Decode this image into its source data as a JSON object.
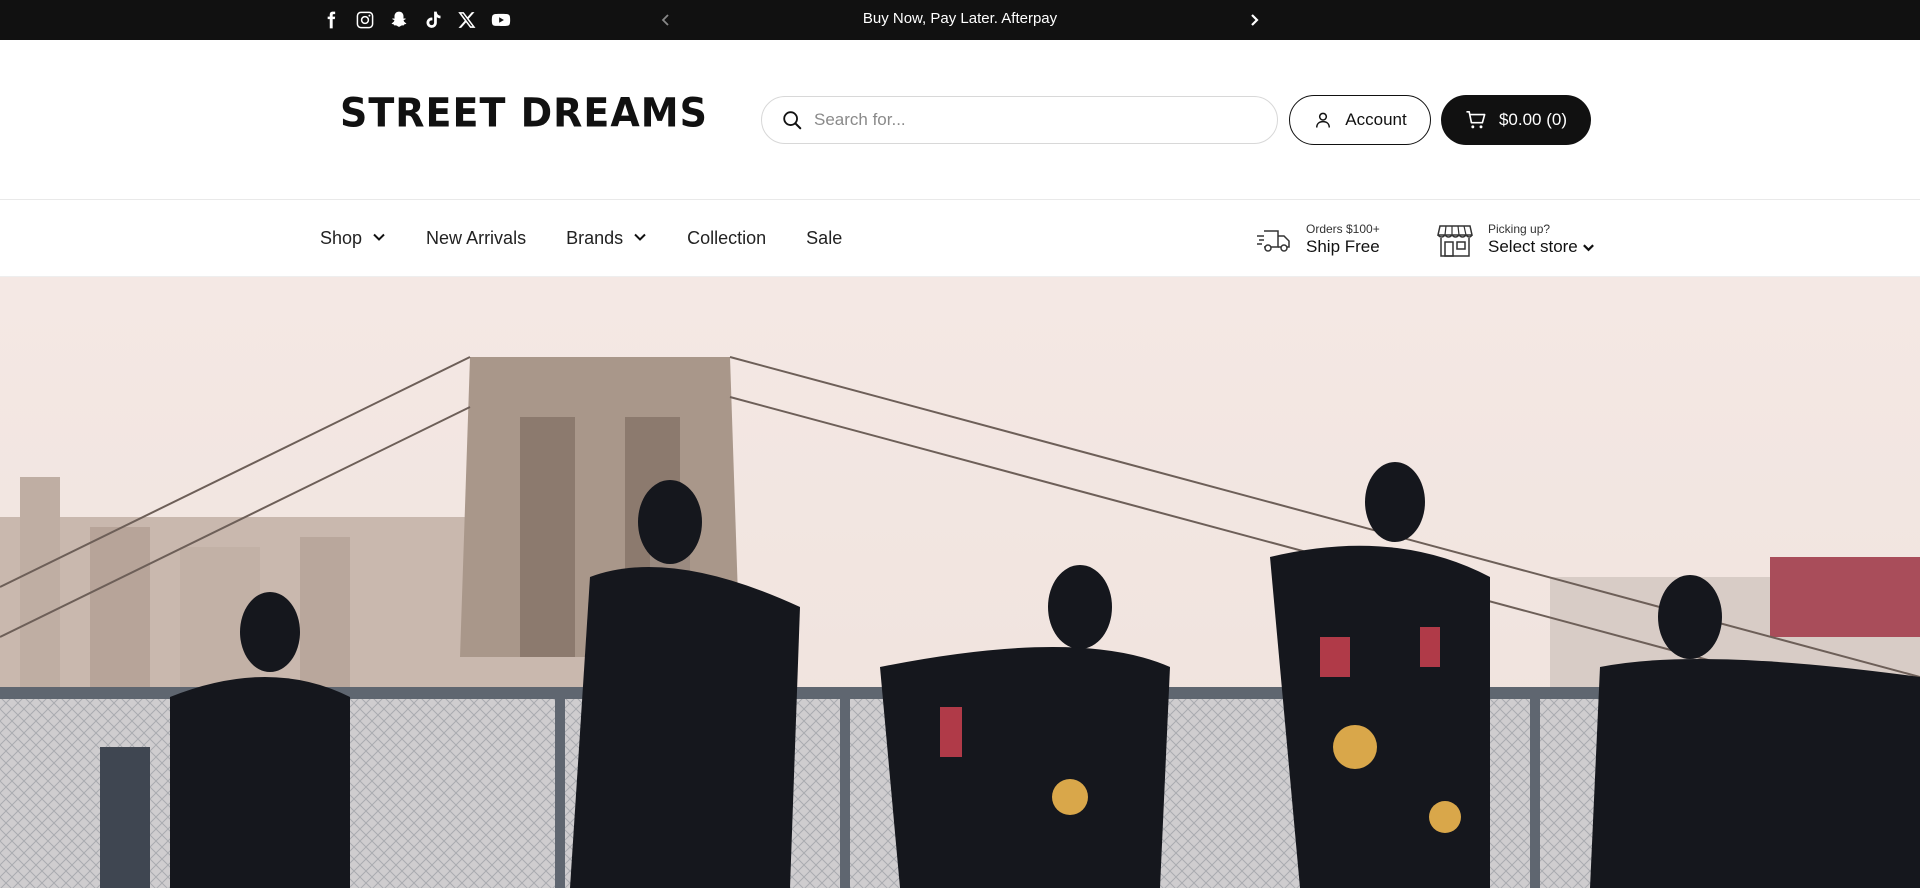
{
  "topbar": {
    "socials": [
      {
        "icon": "facebook-icon"
      },
      {
        "icon": "instagram-icon"
      },
      {
        "icon": "snapchat-icon"
      },
      {
        "icon": "tiktok-icon"
      },
      {
        "icon": "x-twitter-icon"
      },
      {
        "icon": "youtube-icon"
      }
    ],
    "announcement": "Buy Now, Pay Later. Afterpay"
  },
  "header": {
    "logo": "STREET DREAMS",
    "search_placeholder": "Search for...",
    "account_label": "Account",
    "cart_label": "$0.00 (0)"
  },
  "nav": {
    "items": [
      {
        "label": "Shop",
        "has_dropdown": true
      },
      {
        "label": "New Arrivals",
        "has_dropdown": false
      },
      {
        "label": "Brands",
        "has_dropdown": true
      },
      {
        "label": "Collection",
        "has_dropdown": false
      },
      {
        "label": "Sale",
        "has_dropdown": false
      }
    ],
    "shipping": {
      "small": "Orders $100+",
      "big": "Ship Free"
    },
    "store": {
      "small": "Picking up?",
      "big": "Select store"
    }
  },
  "colors": {
    "topbar_bg": "#111111",
    "cart_bg": "#111111",
    "hero_sky": "#f3e6e2"
  }
}
